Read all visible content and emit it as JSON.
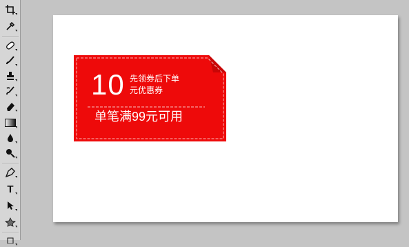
{
  "toolbar": {
    "tools": [
      {
        "name": "crop-tool-icon",
        "glyph": "⌗"
      },
      {
        "name": "eyedropper-tool-icon",
        "glyph": "⁄"
      },
      {
        "name": "healing-brush-tool-icon",
        "glyph": "⊘"
      },
      {
        "name": "brush-tool-icon",
        "glyph": "✎"
      },
      {
        "name": "clone-stamp-tool-icon",
        "glyph": "⊥"
      },
      {
        "name": "history-brush-tool-icon",
        "glyph": "✐"
      },
      {
        "name": "eraser-tool-icon",
        "glyph": "◩"
      },
      {
        "name": "gradient-tool-icon",
        "glyph": "▭"
      },
      {
        "name": "blur-tool-icon",
        "glyph": "♦"
      },
      {
        "name": "dodge-tool-icon",
        "glyph": "●"
      },
      {
        "name": "pen-tool-icon",
        "glyph": "✒"
      },
      {
        "name": "type-tool-icon",
        "glyph": "T"
      },
      {
        "name": "path-selection-tool-icon",
        "glyph": "➤"
      },
      {
        "name": "custom-shape-tool-icon",
        "glyph": "✱"
      }
    ]
  },
  "coupon": {
    "amount": "10",
    "desc_line1": "先领券后下单",
    "desc_line2": "元优惠券",
    "condition": "单笔满99元可用",
    "bg_color": "#ee0a0a",
    "text_color": "#ffffff"
  }
}
